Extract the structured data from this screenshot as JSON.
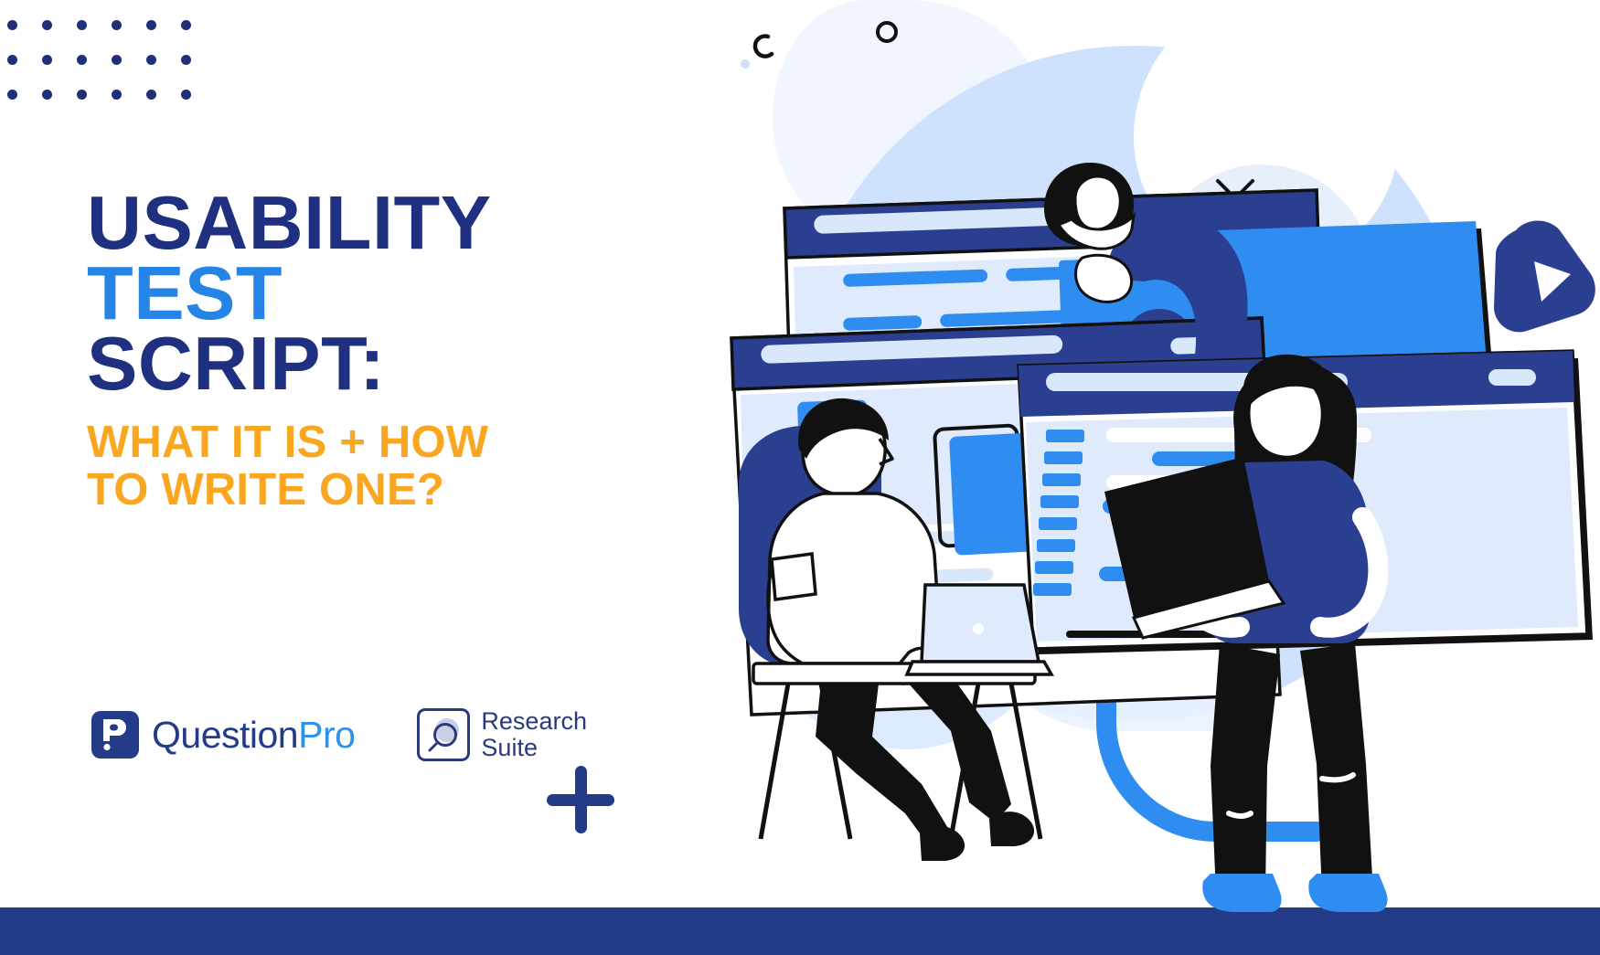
{
  "poster": {
    "background_color": "#ffffff",
    "accent_navy": "#1f3080",
    "accent_blue": "#2684e6",
    "accent_orange": "#f9a721",
    "headline": {
      "line1": "USABILITY",
      "line2": "TEST",
      "line3": "SCRIPT:"
    },
    "subtitle": {
      "line1": "WHAT IT IS + HOW",
      "line2": "TO WRITE ONE?"
    }
  },
  "branding": {
    "questionpro": {
      "mark_icon": "questionpro-p-mark-icon",
      "name_part1": "Question",
      "name_part2": "Pro"
    },
    "research_suite": {
      "mark_icon": "magnifier-icon",
      "line1": "Research",
      "line2": "Suite"
    }
  },
  "decorations": {
    "dot_grid": {
      "icon": "dot-grid-icon",
      "rows": 3,
      "columns": 6,
      "color": "#1f2f7a"
    },
    "plus": {
      "icon": "plus-icon",
      "color": "#233b86"
    },
    "bottom_bar_color": "#233b86",
    "right_play_badge": {
      "icon": "play-triangle-icon",
      "color": "#2b3f91"
    },
    "sparkle": {
      "icon": "sparkle-x-icon"
    },
    "small_c": {
      "icon": "c-letter-icon"
    },
    "small_circle": {
      "icon": "circle-outline-icon"
    }
  },
  "illustration": {
    "name": "usability-testing-illustration",
    "characters": [
      {
        "name": "seated-man-with-laptop",
        "description": "man seated at desk working on laptop"
      },
      {
        "name": "man-leaning-over-screen",
        "description": "man leaning over top of a large screen"
      },
      {
        "name": "standing-woman-with-laptop",
        "description": "woman standing holding an open laptop"
      }
    ],
    "screens": [
      {
        "name": "browser-window-back",
        "has_video_player": true
      },
      {
        "name": "browser-window-middle",
        "has_video_player": false
      },
      {
        "name": "monitor-right",
        "has_video_player": false
      },
      {
        "name": "browser-window-front",
        "has_list_rows": true
      }
    ],
    "play_button_icon": "play-button-icon"
  }
}
